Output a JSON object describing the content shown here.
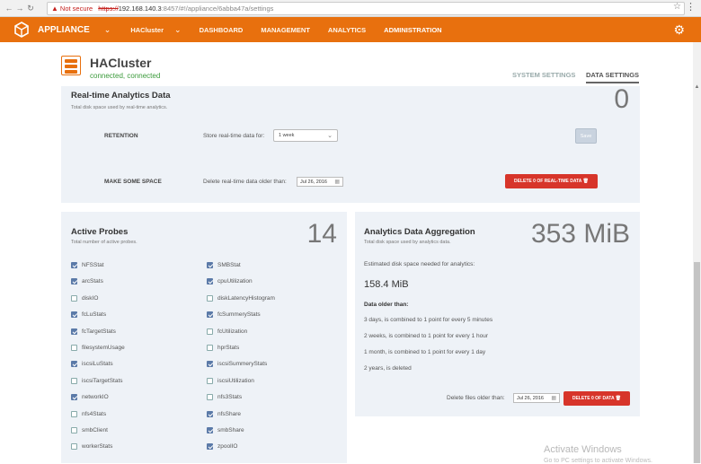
{
  "browser": {
    "not_secure": "Not secure",
    "url_scheme": "https://",
    "url_host": "192.168.140.3",
    "url_path": ":8457/#!/appliance/6abba47a/settings"
  },
  "appbar": {
    "app_name": "APPLIANCE",
    "nav": [
      {
        "label": "HACluster"
      },
      {
        "label": "DASHBOARD"
      },
      {
        "label": "MANAGEMENT"
      },
      {
        "label": "ANALYTICS"
      },
      {
        "label": "ADMINISTRATION"
      }
    ],
    "accent_color": "#e8700e"
  },
  "header": {
    "title": "HACluster",
    "status": "connected, connected",
    "tabs": [
      {
        "label": "SYSTEM SETTINGS"
      },
      {
        "label": "DATA SETTINGS"
      }
    ]
  },
  "realtime": {
    "title": "Real-time Analytics Data",
    "subtitle": "Total disk space used by real-time analytics.",
    "count": "0",
    "retention_label": "RETENTION",
    "retention_text": "Store real-time data for:",
    "retention_value": "1 week",
    "save_label": "Save",
    "space_label": "MAKE SOME SPACE",
    "space_text": "Delete real-time data older than:",
    "space_date": "Jul 26, 2016",
    "delete_label": "DELETE 0 OF REAL-TIME DATA"
  },
  "probes": {
    "title": "Active Probes",
    "subtitle": "Total number of active probes.",
    "count": "14",
    "left": [
      {
        "label": "NFSStat",
        "checked": true
      },
      {
        "label": "arcStats",
        "checked": true
      },
      {
        "label": "diskIO",
        "checked": false
      },
      {
        "label": "fcLuStats",
        "checked": true
      },
      {
        "label": "fcTargetStats",
        "checked": true
      },
      {
        "label": "filesystemUsage",
        "checked": false
      },
      {
        "label": "iscsiLuStats",
        "checked": true
      },
      {
        "label": "iscsiTargetStats",
        "checked": false
      },
      {
        "label": "networkIO",
        "checked": true
      },
      {
        "label": "nfs4Stats",
        "checked": false
      },
      {
        "label": "smbClient",
        "checked": false
      },
      {
        "label": "workerStats",
        "checked": false
      }
    ],
    "right": [
      {
        "label": "SMBStat",
        "checked": true
      },
      {
        "label": "cpuUtilization",
        "checked": true
      },
      {
        "label": "diskLatencyHistogram",
        "checked": false
      },
      {
        "label": "fcSummeryStats",
        "checked": true
      },
      {
        "label": "fcUtilization",
        "checked": false
      },
      {
        "label": "hprStats",
        "checked": false
      },
      {
        "label": "iscsiSummeryStats",
        "checked": true
      },
      {
        "label": "iscsiUtilization",
        "checked": false
      },
      {
        "label": "nfs3Stats",
        "checked": false
      },
      {
        "label": "nfsShare",
        "checked": true
      },
      {
        "label": "smbShare",
        "checked": true
      },
      {
        "label": "zpoolIO",
        "checked": true
      }
    ]
  },
  "aggregation": {
    "title": "Analytics Data Aggregation",
    "subtitle": "Total disk space used by analytics data.",
    "size": "353 MiB",
    "estimated_label": "Estimated disk space needed for analytics:",
    "estimated_value": "158.4 MiB",
    "older_label": "Data older than:",
    "rules": [
      "3 days, is combined to 1 point for every 5 minutes",
      "2 weeks, is combined to 1 point for every 1 hour",
      "1 month, is combined to 1 point for every 1 day",
      "2 years, is deleted"
    ],
    "delete_text": "Delete files older than:",
    "delete_date": "Jul 26, 2016",
    "delete_label": "DELETE 0 OF DATA"
  },
  "watermark": {
    "line1": "Activate Windows",
    "line2": "Go to PC settings to activate Windows."
  }
}
